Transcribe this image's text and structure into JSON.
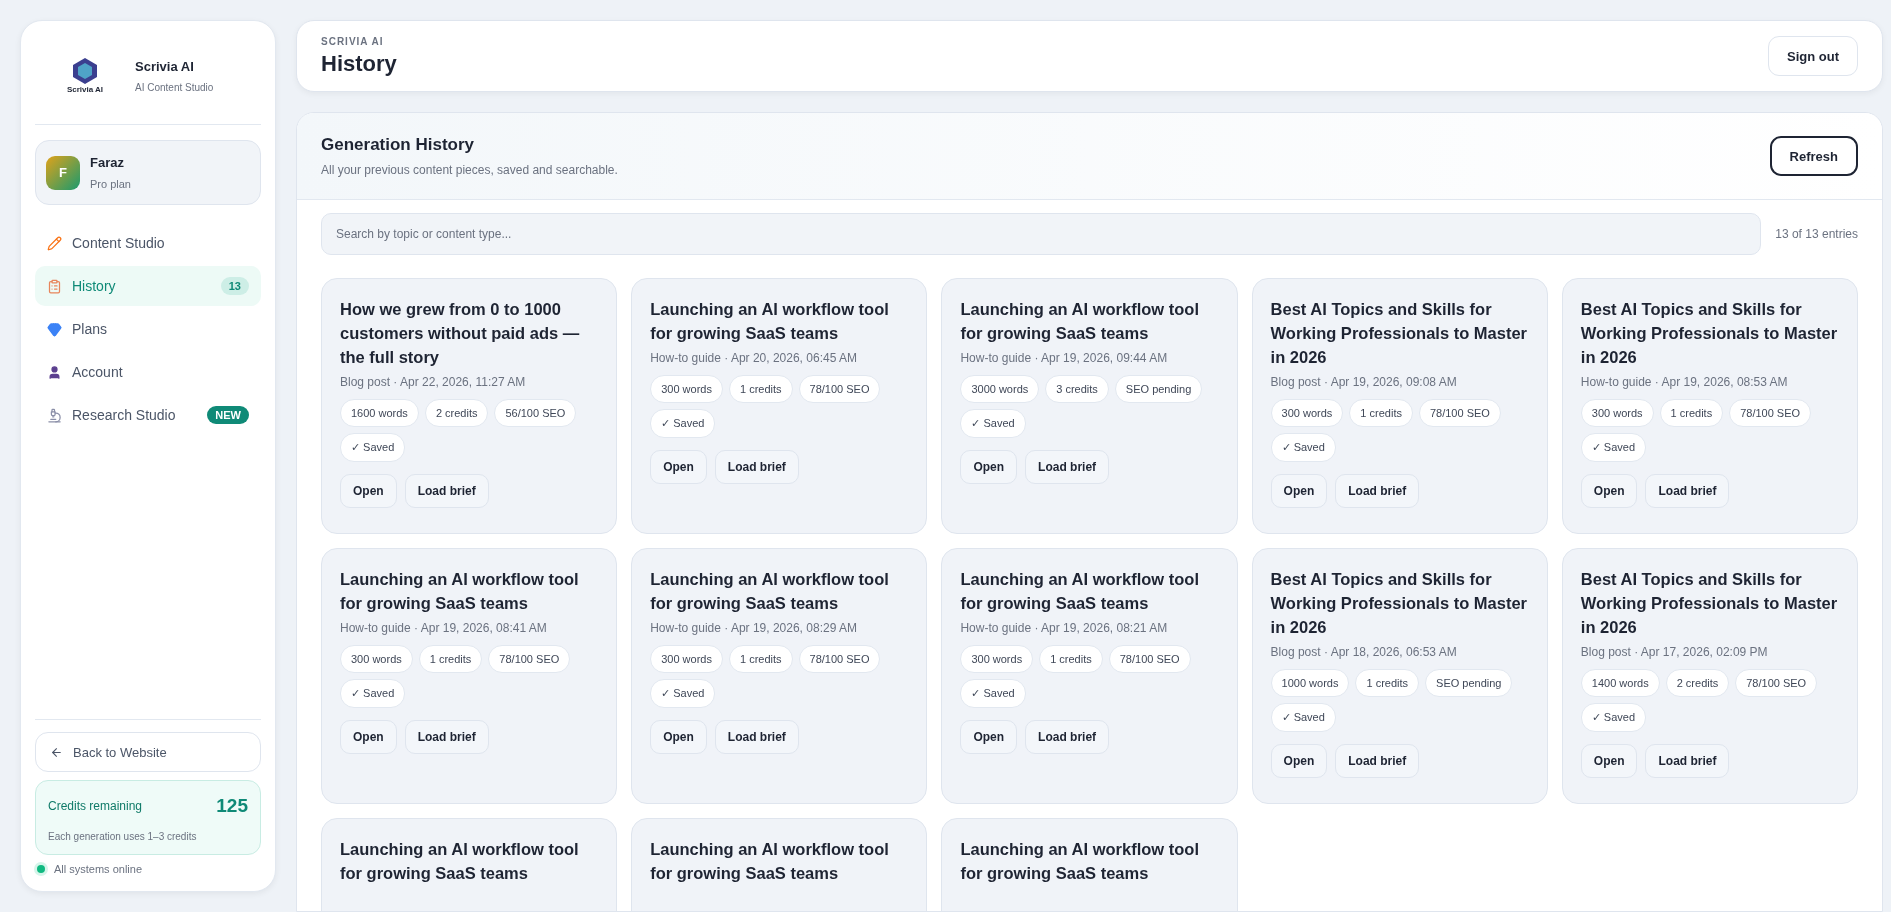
{
  "sidebar": {
    "brand": {
      "logo_text": "Scrivia AI",
      "name": "Scrivia AI",
      "tagline": "AI Content Studio"
    },
    "user": {
      "initial": "F",
      "name": "Faraz",
      "plan": "Pro plan"
    },
    "nav": [
      {
        "label": "Content Studio",
        "kind": "plain",
        "selected": false
      },
      {
        "label": "History",
        "kind": "count",
        "selected": true,
        "badge": "13"
      },
      {
        "label": "Plans",
        "kind": "plain",
        "selected": false
      },
      {
        "label": "Account",
        "kind": "plain",
        "selected": false
      },
      {
        "label": "Research Studio",
        "kind": "new",
        "selected": false,
        "badge": "NEW"
      }
    ],
    "back_link": "Back to Website",
    "credits": {
      "label": "Credits remaining",
      "value": "125",
      "note": "Each generation uses 1–3 credits"
    },
    "status": {
      "text": "All systems online",
      "online": true
    }
  },
  "header": {
    "eyebrow": "SCRIVIA AI",
    "title": "History",
    "button": "Sign out"
  },
  "panel": {
    "title": "Generation History",
    "subtitle": "All your previous content pieces, saved and searchable.",
    "button": "Refresh",
    "search": {
      "placeholder": "Search by topic or content type..."
    },
    "count": "13 of 13 entries",
    "cards": [
      {
        "title": "How we grew from 0 to 1000 customers without paid ads — the full story",
        "meta": "Blog post · Apr 22, 2026, 11:27 AM",
        "chips": [
          "1600 words",
          "2 credits",
          "56/100 SEO"
        ],
        "saved": "✓ Saved",
        "actions": [
          "Open",
          "Load brief"
        ]
      },
      {
        "title": "Launching an AI workflow tool for growing SaaS teams",
        "meta": "How-to guide · Apr 20, 2026, 06:45 AM",
        "chips": [
          "300 words",
          "1 credits",
          "78/100 SEO"
        ],
        "saved": "✓ Saved",
        "actions": [
          "Open",
          "Load brief"
        ]
      },
      {
        "title": "Launching an AI workflow tool for growing SaaS teams",
        "meta": "How-to guide · Apr 19, 2026, 09:44 AM",
        "chips": [
          "3000 words",
          "3 credits",
          "SEO pending"
        ],
        "saved": "✓ Saved",
        "actions": [
          "Open",
          "Load brief"
        ]
      },
      {
        "title": "Best AI Topics and Skills for Working Professionals to Master in 2026",
        "meta": "Blog post · Apr 19, 2026, 09:08 AM",
        "chips": [
          "300 words",
          "1 credits",
          "78/100 SEO"
        ],
        "saved": "✓ Saved",
        "actions": [
          "Open",
          "Load brief"
        ]
      },
      {
        "title": "Best AI Topics and Skills for Working Professionals to Master in 2026",
        "meta": "How-to guide · Apr 19, 2026, 08:53 AM",
        "chips": [
          "300 words",
          "1 credits",
          "78/100 SEO"
        ],
        "saved": "✓ Saved",
        "actions": [
          "Open",
          "Load brief"
        ]
      },
      {
        "title": "Launching an AI workflow tool for growing SaaS teams",
        "meta": "How-to guide · Apr 19, 2026, 08:41 AM",
        "chips": [
          "300 words",
          "1 credits",
          "78/100 SEO"
        ],
        "saved": "✓ Saved",
        "actions": [
          "Open",
          "Load brief"
        ]
      },
      {
        "title": "Launching an AI workflow tool for growing SaaS teams",
        "meta": "How-to guide · Apr 19, 2026, 08:29 AM",
        "chips": [
          "300 words",
          "1 credits",
          "78/100 SEO"
        ],
        "saved": "✓ Saved",
        "actions": [
          "Open",
          "Load brief"
        ]
      },
      {
        "title": "Launching an AI workflow tool for growing SaaS teams",
        "meta": "How-to guide · Apr 19, 2026, 08:21 AM",
        "chips": [
          "300 words",
          "1 credits",
          "78/100 SEO"
        ],
        "saved": "✓ Saved",
        "actions": [
          "Open",
          "Load brief"
        ]
      },
      {
        "title": "Best AI Topics and Skills for Working Professionals to Master in 2026",
        "meta": "Blog post · Apr 18, 2026, 06:53 AM",
        "chips": [
          "1000 words",
          "1 credits",
          "SEO pending"
        ],
        "saved": "✓ Saved",
        "actions": [
          "Open",
          "Load brief"
        ]
      },
      {
        "title": "Best AI Topics and Skills for Working Professionals to Master in 2026",
        "meta": "Blog post · Apr 17, 2026, 02:09 PM",
        "chips": [
          "1400 words",
          "2 credits",
          "78/100 SEO"
        ],
        "saved": "✓ Saved",
        "actions": [
          "Open",
          "Load brief"
        ]
      },
      {
        "title": "Launching an AI workflow tool for growing SaaS teams"
      },
      {
        "title": "Launching an AI workflow tool for growing SaaS teams"
      },
      {
        "title": "Launching an AI workflow tool for growing SaaS teams"
      }
    ]
  }
}
